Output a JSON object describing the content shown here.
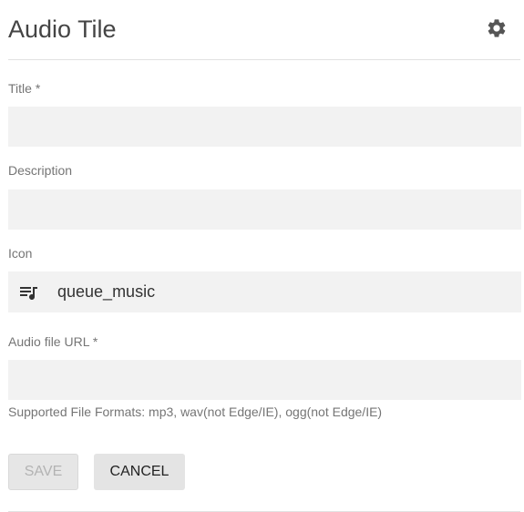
{
  "header": {
    "title": "Audio Tile",
    "settings_icon": "gear-icon"
  },
  "form": {
    "title": {
      "label": "Title *",
      "value": ""
    },
    "description": {
      "label": "Description",
      "value": ""
    },
    "icon": {
      "label": "Icon",
      "icon_name": "queue-music-icon",
      "value": "queue_music"
    },
    "audio_url": {
      "label": "Audio file URL *",
      "value": "",
      "hint": "Supported File Formats: mp3, wav(not Edge/IE), ogg(not Edge/IE)"
    }
  },
  "actions": {
    "save_label": "SAVE",
    "save_disabled": true,
    "cancel_label": "CANCEL"
  },
  "colors": {
    "field_background": "#f2f2f2",
    "label_text": "#757575",
    "disabled_text": "#b3b3b3"
  }
}
